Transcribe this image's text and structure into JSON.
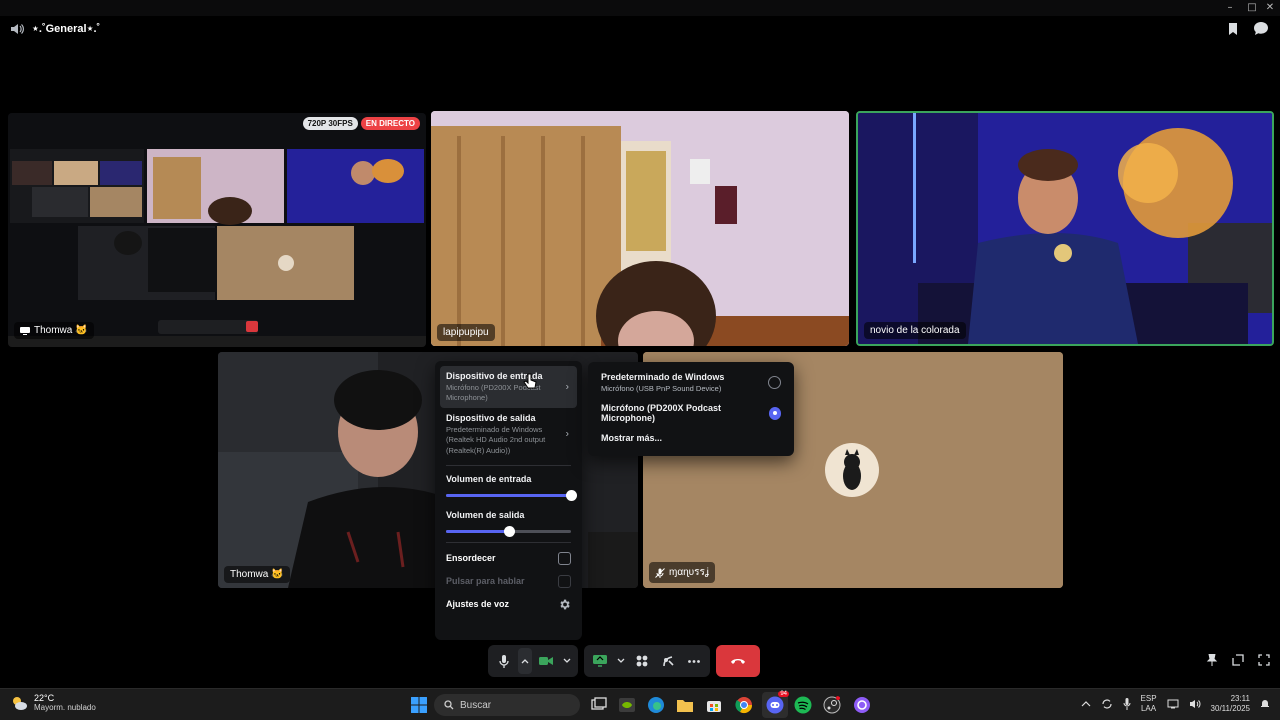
{
  "channel": {
    "name": "⋆.˚General⋆.˚"
  },
  "tiles": [
    {
      "label": "Thomwa 🐱",
      "badges": {
        "resolution": "720P 30FPS",
        "live": "EN DIRECTO"
      }
    },
    {
      "label": "lapipupipu"
    },
    {
      "label": "novio de la colorada"
    },
    {
      "label": "Thomwa 🐱"
    },
    {
      "label": "ɱαɳυรรʝ"
    }
  ],
  "audio_menu": {
    "input_device": {
      "title": "Dispositivo de entrada",
      "value": "Micrófono (PD200X Podcast Microphone)"
    },
    "output_device": {
      "title": "Dispositivo de salida",
      "value": "Predeterminado de Windows (Realtek HD Audio 2nd output (Realtek(R) Audio))"
    },
    "input_volume": {
      "label": "Volumen de entrada",
      "level": 1.0
    },
    "output_volume": {
      "label": "Volumen de salida",
      "level": 0.5
    },
    "deafen": "Ensordecer",
    "push_to_talk": "Pulsar para hablar",
    "voice_settings": "Ajustes de voz"
  },
  "device_menu": {
    "options": [
      {
        "title": "Predeterminado de Windows",
        "sub": "Micrófono (USB PnP Sound Device)",
        "selected": false
      },
      {
        "title": "Micrófono (PD200X Podcast Microphone)",
        "sub": "",
        "selected": true
      }
    ],
    "more": "Mostrar más..."
  },
  "taskbar": {
    "weather_temp": "22°C",
    "weather_desc": "Mayorm. nublado",
    "search_placeholder": "Buscar",
    "lang_1": "ESP",
    "lang_2": "LAA",
    "time": "23:11",
    "date": "30/11/2025",
    "discord_badge": "94"
  },
  "colors": {
    "accent": "#5865f2",
    "speaking": "#3ba55c",
    "hangup": "#da373c",
    "live": "#ed4245"
  }
}
